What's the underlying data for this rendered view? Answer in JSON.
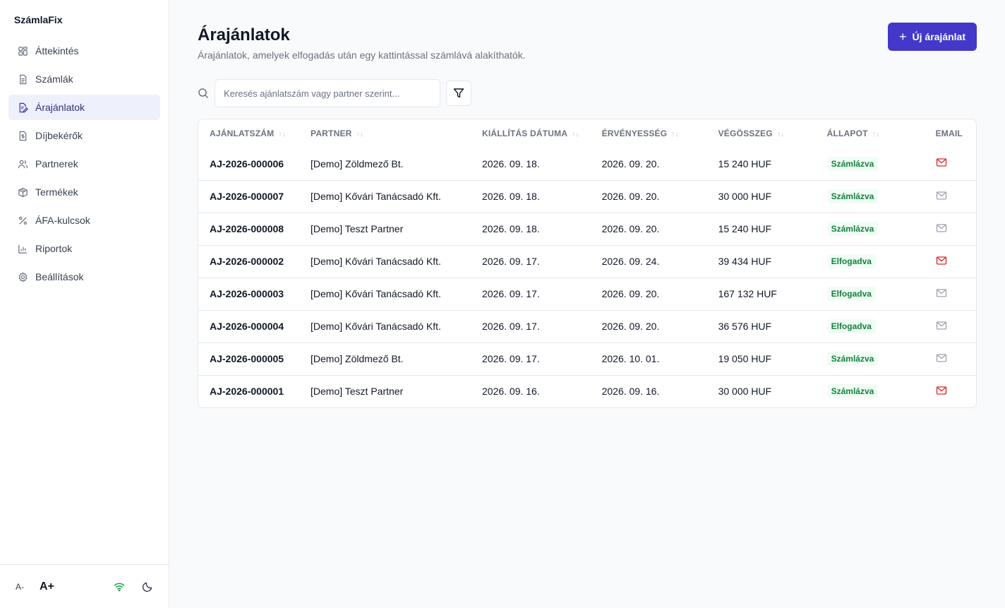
{
  "app": {
    "brand": "SzámlaFix"
  },
  "sidebar": {
    "items": [
      {
        "label": "Áttekintés",
        "icon": "dashboard-icon"
      },
      {
        "label": "Számlák",
        "icon": "invoice-icon"
      },
      {
        "label": "Árajánlatok",
        "icon": "quote-icon",
        "active": true
      },
      {
        "label": "Díjbekérők",
        "icon": "billing-icon"
      },
      {
        "label": "Partnerek",
        "icon": "users-icon"
      },
      {
        "label": "Termékek",
        "icon": "box-icon"
      },
      {
        "label": "ÁFA-kulcsok",
        "icon": "percent-icon"
      },
      {
        "label": "Riportok",
        "icon": "chart-icon"
      },
      {
        "label": "Beállítások",
        "icon": "gear-icon"
      }
    ],
    "footer": {
      "font_decrease": "A-",
      "font_increase": "A+"
    }
  },
  "header": {
    "title": "Árajánlatok",
    "subtitle": "Árajánlatok, amelyek elfogadás után egy kattintással számlává alakíthatók.",
    "new_button": "Új árajánlat"
  },
  "search": {
    "placeholder": "Keresés ajánlatszám vagy partner szerint..."
  },
  "table": {
    "columns": [
      "Ajánlatszám",
      "Partner",
      "Kiállítás dátuma",
      "Érvényesség",
      "Végösszeg",
      "Állapot",
      "Email"
    ],
    "rows": [
      {
        "number": "AJ-2026-000006",
        "partner": "[Demo] Zöldmező Bt.",
        "issued": "2026. 09. 18.",
        "valid": "2026. 09. 20.",
        "total": "15 240 HUF",
        "status": "Számlázva",
        "email_sent": true
      },
      {
        "number": "AJ-2026-000007",
        "partner": "[Demo] Kővári Tanácsadó Kft.",
        "issued": "2026. 09. 18.",
        "valid": "2026. 09. 20.",
        "total": "30 000 HUF",
        "status": "Számlázva",
        "email_sent": false
      },
      {
        "number": "AJ-2026-000008",
        "partner": "[Demo] Teszt Partner",
        "issued": "2026. 09. 18.",
        "valid": "2026. 09. 20.",
        "total": "15 240 HUF",
        "status": "Számlázva",
        "email_sent": false
      },
      {
        "number": "AJ-2026-000002",
        "partner": "[Demo] Kővári Tanácsadó Kft.",
        "issued": "2026. 09. 17.",
        "valid": "2026. 09. 24.",
        "total": "39 434 HUF",
        "status": "Elfogadva",
        "email_sent": true
      },
      {
        "number": "AJ-2026-000003",
        "partner": "[Demo] Kővári Tanácsadó Kft.",
        "issued": "2026. 09. 17.",
        "valid": "2026. 09. 20.",
        "total": "167 132 HUF",
        "status": "Elfogadva",
        "email_sent": false
      },
      {
        "number": "AJ-2026-000004",
        "partner": "[Demo] Kővári Tanácsadó Kft.",
        "issued": "2026. 09. 17.",
        "valid": "2026. 09. 20.",
        "total": "36 576 HUF",
        "status": "Elfogadva",
        "email_sent": false
      },
      {
        "number": "AJ-2026-000005",
        "partner": "[Demo] Zöldmező Bt.",
        "issued": "2026. 09. 17.",
        "valid": "2026. 10. 01.",
        "total": "19 050 HUF",
        "status": "Számlázva",
        "email_sent": false
      },
      {
        "number": "AJ-2026-000001",
        "partner": "[Demo] Teszt Partner",
        "issued": "2026. 09. 16.",
        "valid": "2026. 09. 16.",
        "total": "30 000 HUF",
        "status": "Számlázva",
        "email_sent": true
      }
    ]
  },
  "colors": {
    "accent": "#4338ca",
    "active_bg": "#eef0fb",
    "badge_green": "#15803d",
    "email_sent": "#dc2626"
  }
}
